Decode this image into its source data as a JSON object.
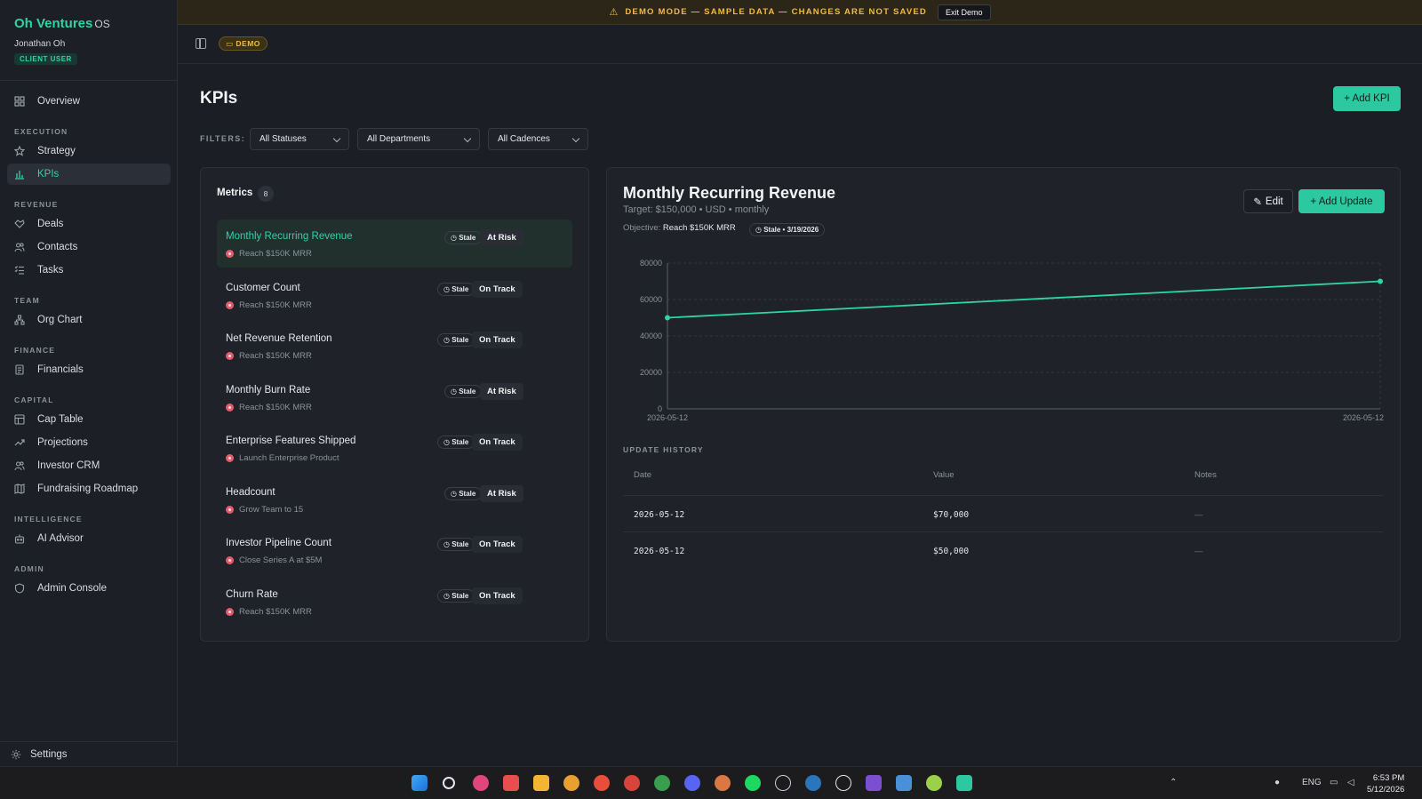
{
  "sidebar": {
    "brand": "Oh Ventures",
    "brand_suffix": "OS",
    "user_name": "Jonathan Oh",
    "role": "CLIENT USER",
    "overview": "Overview",
    "sections": {
      "execution": "EXECUTION",
      "revenue": "REVENUE",
      "team": "TEAM",
      "finance": "FINANCE",
      "capital": "CAPITAL",
      "intelligence": "INTELLIGENCE",
      "admin": "ADMIN"
    },
    "items": {
      "strategy": "Strategy",
      "kpis": "KPIs",
      "deals": "Deals",
      "contacts": "Contacts",
      "tasks": "Tasks",
      "org_chart": "Org Chart",
      "financials": "Financials",
      "cap_table": "Cap Table",
      "projections": "Projections",
      "investor_crm": "Investor CRM",
      "fundraising_roadmap": "Fundraising Roadmap",
      "ai_advisor": "AI Advisor",
      "admin_console": "Admin Console"
    },
    "settings": "Settings"
  },
  "banner": {
    "text": "DEMO MODE — SAMPLE DATA — CHANGES ARE NOT SAVED",
    "exit_label": "Exit Demo"
  },
  "topbar": {
    "demo_badge": "DEMO"
  },
  "page": {
    "title": "KPIs",
    "add_kpi": "+ Add KPI",
    "filters_label": "FILTERS:",
    "filters": [
      "All Statuses",
      "All Departments",
      "All Cadences"
    ]
  },
  "metrics": {
    "title": "Metrics",
    "count": "8",
    "stale_label": "Stale",
    "rows": [
      {
        "name": "Monthly Recurring Revenue",
        "objective": "Reach $150K MRR",
        "status": "At Risk"
      },
      {
        "name": "Customer Count",
        "objective": "Reach $150K MRR",
        "status": "On Track"
      },
      {
        "name": "Net Revenue Retention",
        "objective": "Reach $150K MRR",
        "status": "On Track"
      },
      {
        "name": "Monthly Burn Rate",
        "objective": "Reach $150K MRR",
        "status": "At Risk"
      },
      {
        "name": "Enterprise Features Shipped",
        "objective": "Launch Enterprise Product",
        "status": "On Track"
      },
      {
        "name": "Headcount",
        "objective": "Grow Team to 15",
        "status": "At Risk"
      },
      {
        "name": "Investor Pipeline Count",
        "objective": "Close Series A at $5M",
        "status": "On Track"
      },
      {
        "name": "Churn Rate",
        "objective": "Reach $150K MRR",
        "status": "On Track"
      }
    ]
  },
  "detail": {
    "title": "Monthly Recurring Revenue",
    "target": "Target: $150,000 • USD • monthly",
    "objective_label": "Objective:",
    "objective_value": "Reach $150K MRR",
    "stale_date": "Stale • 3/19/2026",
    "edit_label": "Edit",
    "add_update_label": "+ Add Update",
    "history_title": "UPDATE HISTORY",
    "columns": [
      "Date",
      "Value",
      "Notes"
    ],
    "history": [
      {
        "date": "2026-05-12",
        "value": "$70,000",
        "notes": "—"
      },
      {
        "date": "2026-05-12",
        "value": "$50,000",
        "notes": "—"
      }
    ]
  },
  "chart_data": {
    "type": "line",
    "x": [
      "2026-05-12",
      "2026-05-12"
    ],
    "series": [
      {
        "values": [
          50000,
          70000
        ]
      }
    ],
    "y_ticks": [
      0,
      20000,
      40000,
      60000,
      80000
    ],
    "ylim": [
      0,
      80000
    ],
    "grid": true,
    "color": "#2dd4a7"
  },
  "taskbar": {
    "lang": "ENG",
    "time": "6:53 PM",
    "date": "5/12/2026"
  }
}
